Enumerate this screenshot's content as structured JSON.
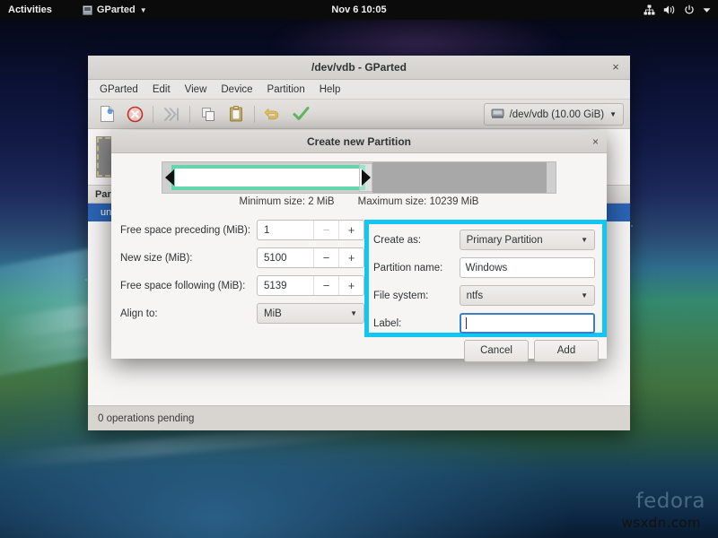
{
  "topbar": {
    "activities": "Activities",
    "app_name": "GParted",
    "app_icon": "gparted-app-icon",
    "clock": "Nov 6  10:05",
    "icons": [
      "network-icon",
      "volume-icon",
      "power-icon",
      "chevron-down-icon"
    ]
  },
  "gparted_window": {
    "title": "/dev/vdb - GParted",
    "close_label": "×",
    "menus": [
      "GParted",
      "Edit",
      "View",
      "Device",
      "Partition",
      "Help"
    ],
    "toolbar": [
      {
        "name": "new-partition-icon",
        "enabled": true
      },
      {
        "name": "delete-partition-icon",
        "enabled": true
      },
      {
        "name": "resize-move-icon",
        "enabled": false
      },
      {
        "name": "copy-icon",
        "enabled": true
      },
      {
        "name": "paste-icon",
        "enabled": true
      },
      {
        "name": "undo-icon",
        "enabled": true
      },
      {
        "name": "apply-icon",
        "enabled": true
      }
    ],
    "device_selector": {
      "icon": "harddisk-icon",
      "label": "/dev/vdb (10.00 GiB)",
      "caret": "▼"
    },
    "list_header": "Part",
    "selected_row": "un",
    "statusbar": "0 operations pending"
  },
  "dialog": {
    "title": "Create new Partition",
    "close_label": "×",
    "minimum_size": "Minimum size: 2 MiB",
    "maximum_size": "Maximum size: 10239 MiB",
    "left_fields": {
      "free_preceding": {
        "label": "Free space preceding (MiB):",
        "value": "1",
        "minus": "−",
        "plus": "+",
        "minus_enabled": false
      },
      "new_size": {
        "label": "New size (MiB):",
        "value": "5100",
        "minus": "−",
        "plus": "+",
        "minus_enabled": true
      },
      "free_following": {
        "label": "Free space following (MiB):",
        "value": "5139",
        "minus": "−",
        "plus": "+",
        "minus_enabled": true
      },
      "align_to": {
        "label": "Align to:",
        "value": "MiB",
        "caret": "▼"
      }
    },
    "right_fields": {
      "create_as": {
        "label": "Create as:",
        "value": "Primary Partition",
        "caret": "▼"
      },
      "partition_name": {
        "label": "Partition name:",
        "value": "Windows"
      },
      "file_system": {
        "label": "File system:",
        "value": "ntfs",
        "caret": "▼"
      },
      "label_field": {
        "label": "Label:",
        "value": "",
        "focused": true
      }
    },
    "buttons": {
      "cancel": "Cancel",
      "add": "Add"
    },
    "highlight_color": "#12c6f2"
  },
  "desktop": {
    "fedora_watermark": "fedora",
    "site_watermark": "wsxdn.com"
  }
}
